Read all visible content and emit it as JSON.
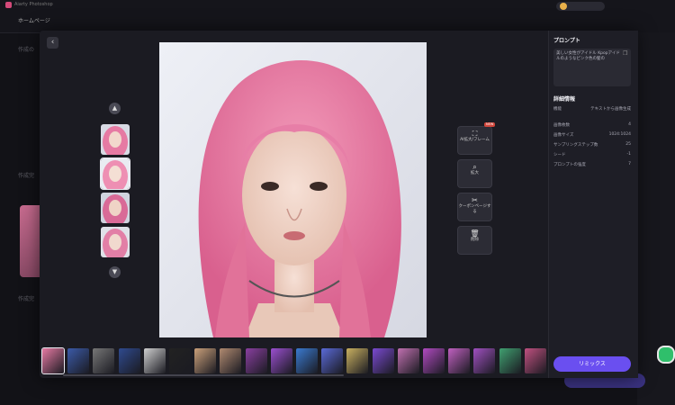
{
  "app": {
    "title": "Aiarty Photoshop",
    "home_label": "ホームページ",
    "bg_texts": [
      "作成の",
      "作成完",
      "作成完"
    ]
  },
  "modal": {
    "back_icon": "chevron-left-icon",
    "variant_thumbs": 4,
    "tools": [
      {
        "icon": "ai-expand-icon",
        "label": "AI拡大/フレーム",
        "badge": "NEW"
      },
      {
        "icon": "zoom-icon",
        "label": "拡大"
      },
      {
        "icon": "coupon-icon",
        "label": "クーポンページする"
      },
      {
        "icon": "trash-icon",
        "label": "削除"
      }
    ]
  },
  "panel": {
    "prompt_title": "プロンプト",
    "prompt_text": "美しい女性がアイドル Kpopアイドルのようなピンク色の髪の",
    "copy_icon": "copy-icon",
    "details_title": "詳細情報",
    "details": [
      {
        "label": "機能",
        "value": "テキストから画像生成"
      },
      {
        "label": "画像枚数",
        "value": "4"
      },
      {
        "label": "画像サイズ",
        "value": "1024:1024"
      },
      {
        "label": "サンプリングステップ数",
        "value": "25"
      },
      {
        "label": "シード",
        "value": "-1"
      },
      {
        "label": "プロンプトの強度",
        "value": "7"
      }
    ],
    "remix_label": "リミックス"
  },
  "colors": {
    "accent": "#6a4ff0",
    "hair": "#e67aa3",
    "background": "#121217"
  }
}
